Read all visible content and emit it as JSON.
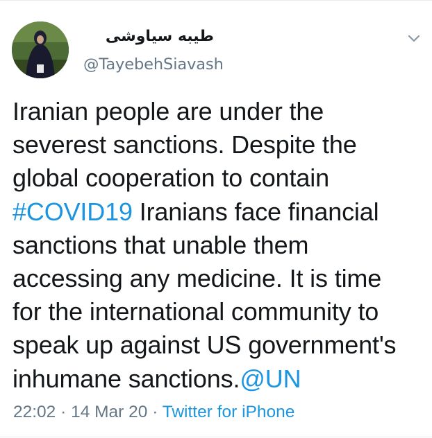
{
  "tweet": {
    "display_name": "طیبه سیاوشی",
    "handle": "@TayebehSiavash",
    "lines": [
      [
        {
          "text": "Iranian people are under the"
        }
      ],
      [
        {
          "text": "severest sanctions. Despite the"
        }
      ],
      [
        {
          "text": "global cooperation to contain"
        }
      ],
      [
        {
          "text": "#COVID19",
          "link": true
        },
        {
          "text": " Iranians face financial"
        }
      ],
      [
        {
          "text": "sanctions that unable them"
        }
      ],
      [
        {
          "text": "accessing any medicine. It is time"
        }
      ],
      [
        {
          "text": "for the international community to"
        }
      ],
      [
        {
          "text": "speak up against US government's"
        }
      ],
      [
        {
          "text": "inhumane sanctions."
        },
        {
          "text": "@UN",
          "link": true
        }
      ]
    ],
    "time": "22:02",
    "separator": " · ",
    "date": "14 Mar 20",
    "source": "Twitter for iPhone",
    "menu_icon": "chevron-down-icon"
  },
  "colors": {
    "text": "#14171a",
    "muted": "#657786",
    "link": "#1b95e0",
    "border": "#e6ecf0"
  }
}
